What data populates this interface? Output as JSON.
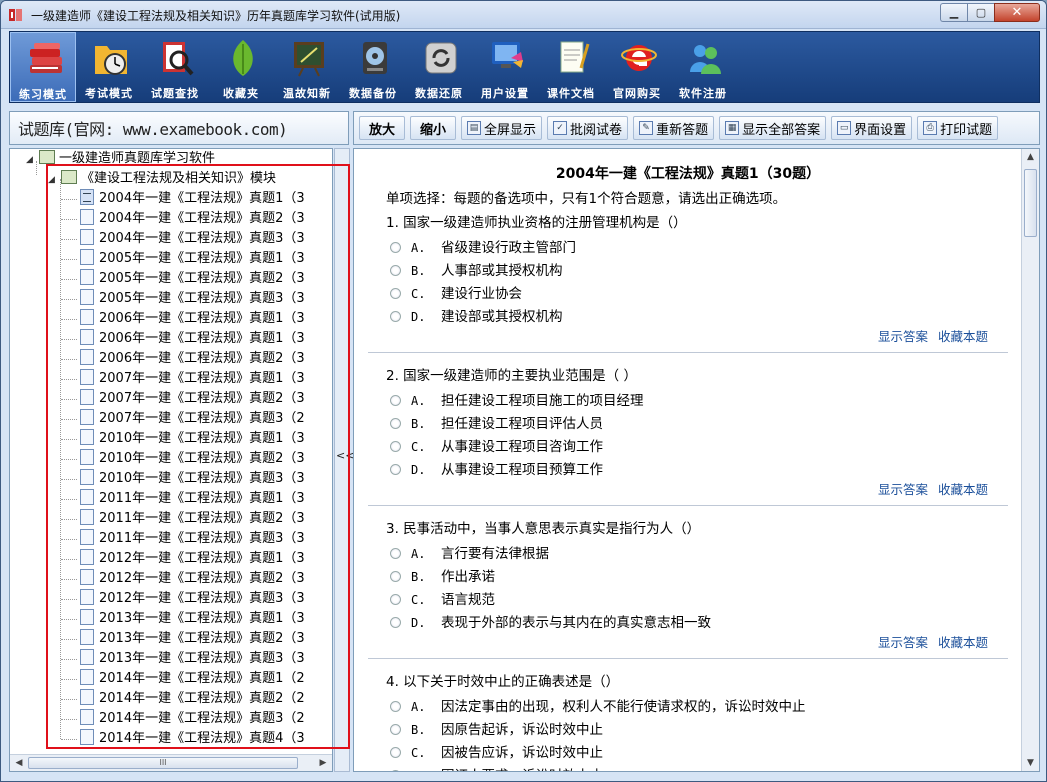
{
  "window": {
    "title": "一级建造师《建设工程法规及相关知识》历年真题库学习软件(试用版)",
    "min_label": "▁",
    "max_label": "▢",
    "close_label": "✕"
  },
  "toolbar": {
    "items": [
      {
        "label": "练习模式",
        "icon": "books-icon",
        "active": true
      },
      {
        "label": "考试模式",
        "icon": "clock-folder-icon"
      },
      {
        "label": "试题查找",
        "icon": "magnifier-book-icon"
      },
      {
        "label": "收藏夹",
        "icon": "leaf-icon"
      },
      {
        "label": "温故知新",
        "icon": "chalkboard-icon"
      },
      {
        "label": "数据备份",
        "icon": "disk-icon"
      },
      {
        "label": "数据还原",
        "icon": "restore-icon"
      },
      {
        "label": "用户设置",
        "icon": "monitor-icon"
      },
      {
        "label": "课件文档",
        "icon": "document-icon"
      },
      {
        "label": "官网购买",
        "icon": "ie-icon"
      },
      {
        "label": "软件注册",
        "icon": "users-icon"
      }
    ]
  },
  "library": {
    "header": "试题库(官网: www.examebook.com)",
    "root": "一级建造师真题库学习软件",
    "module": "《建设工程法规及相关知识》模块",
    "items": [
      "2004年一建《工程法规》真题1（3",
      "2004年一建《工程法规》真题2（3",
      "2004年一建《工程法规》真题3（3",
      "2005年一建《工程法规》真题1（3",
      "2005年一建《工程法规》真题2（3",
      "2005年一建《工程法规》真题3（3",
      "2006年一建《工程法规》真题1（3",
      "2006年一建《工程法规》真题1（3",
      "2006年一建《工程法规》真题2（3",
      "2007年一建《工程法规》真题1（3",
      "2007年一建《工程法规》真题2（3",
      "2007年一建《工程法规》真题3（2",
      "2010年一建《工程法规》真题1（3",
      "2010年一建《工程法规》真题2（3",
      "2010年一建《工程法规》真题3（3",
      "2011年一建《工程法规》真题1（3",
      "2011年一建《工程法规》真题2（3",
      "2011年一建《工程法规》真题3（3",
      "2012年一建《工程法规》真题1（3",
      "2012年一建《工程法规》真题2（3",
      "2012年一建《工程法规》真题3（3",
      "2013年一建《工程法规》真题1（3",
      "2013年一建《工程法规》真题2（3",
      "2013年一建《工程法规》真题3（3",
      "2014年一建《工程法规》真题1（2",
      "2014年一建《工程法规》真题2（2",
      "2014年一建《工程法规》真题3（2",
      "2014年一建《工程法规》真题4（3"
    ],
    "splitter_label": "<<",
    "scroll_grip": "III"
  },
  "actions": {
    "zoom_in": "放大",
    "zoom_out": "缩小",
    "fullscreen": "全屏显示",
    "grade": "批阅试卷",
    "redo": "重新答题",
    "show_all": "显示全部答案",
    "ui_settings": "界面设置",
    "print": "打印试题"
  },
  "exam": {
    "title": "2004年一建《工程法规》真题1（30题）",
    "instruction": "单项选择：每题的备选项中，只有1个符合题意，请选出正确选项。",
    "show_answer": "显示答案",
    "favorite": "收藏本题",
    "questions": [
      {
        "text": "1. 国家一级建造师执业资格的注册管理机构是（）",
        "options": [
          {
            "key": "A.",
            "text": "省级建设行政主管部门"
          },
          {
            "key": "B.",
            "text": "人事部或其授权机构"
          },
          {
            "key": "C.",
            "text": "建设行业协会"
          },
          {
            "key": "D.",
            "text": "建设部或其授权机构"
          }
        ]
      },
      {
        "text": "2. 国家一级建造师的主要执业范围是（ ）",
        "options": [
          {
            "key": "A.",
            "text": "担任建设工程项目施工的项目经理"
          },
          {
            "key": "B.",
            "text": "担任建设工程项目评估人员"
          },
          {
            "key": "C.",
            "text": "从事建设工程项目咨询工作"
          },
          {
            "key": "D.",
            "text": "从事建设工程项目预算工作"
          }
        ]
      },
      {
        "text": "3. 民事活动中，当事人意思表示真实是指行为人（）",
        "options": [
          {
            "key": "A.",
            "text": "言行要有法律根据"
          },
          {
            "key": "B.",
            "text": "作出承诺"
          },
          {
            "key": "C.",
            "text": "语言规范"
          },
          {
            "key": "D.",
            "text": "表现于外部的表示与其内在的真实意志相一致"
          }
        ]
      },
      {
        "text": "4. 以下关于时效中止的正确表述是（）",
        "options": [
          {
            "key": "A.",
            "text": "因法定事由的出现，权利人不能行使请求权的，诉讼时效中止"
          },
          {
            "key": "B.",
            "text": "因原告起诉，诉讼时效中止"
          },
          {
            "key": "C.",
            "text": "因被告应诉，诉讼时效中止"
          },
          {
            "key": "D.",
            "text": "因证人要求，诉讼时效中止"
          }
        ]
      }
    ]
  }
}
